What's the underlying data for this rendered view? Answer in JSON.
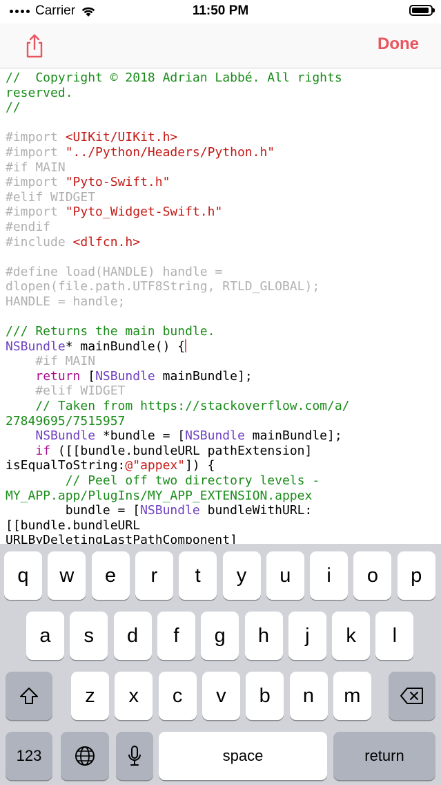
{
  "status_bar": {
    "carrier": "Carrier",
    "time": "11:50 PM",
    "wifi_icon": "wifi-icon",
    "battery_icon": "battery-icon"
  },
  "nav_bar": {
    "share_icon": "share-icon",
    "done_label": "Done",
    "accent_color": "#e8555e"
  },
  "editor": {
    "colors": {
      "comment": "#1a8c1a",
      "preprocessor": "#b0b0b0",
      "string": "#c41a16",
      "keyword": "#aa0d91",
      "type": "#6f41c1",
      "cursor": "#e8555e"
    },
    "lines": [
      [
        {
          "t": "//  Copyright © 2018 Adrian Labbé. All rights",
          "c": "c"
        }
      ],
      [
        {
          "t": "reserved.",
          "c": "c"
        }
      ],
      [
        {
          "t": "//",
          "c": "c"
        }
      ],
      [],
      [
        {
          "t": "#import ",
          "c": "p"
        },
        {
          "t": "<UIKit/UIKit.h>",
          "c": "s"
        }
      ],
      [
        {
          "t": "#import ",
          "c": "p"
        },
        {
          "t": "\"../Python/Headers/Python.h\"",
          "c": "s"
        }
      ],
      [
        {
          "t": "#if MAIN",
          "c": "p"
        }
      ],
      [
        {
          "t": "#import ",
          "c": "p"
        },
        {
          "t": "\"Pyto-Swift.h\"",
          "c": "s"
        }
      ],
      [
        {
          "t": "#elif WIDGET",
          "c": "p"
        }
      ],
      [
        {
          "t": "#import ",
          "c": "p"
        },
        {
          "t": "\"Pyto_Widget-Swift.h\"",
          "c": "s"
        }
      ],
      [
        {
          "t": "#endif",
          "c": "p"
        }
      ],
      [
        {
          "t": "#include ",
          "c": "p"
        },
        {
          "t": "<dlfcn.h>",
          "c": "s"
        }
      ],
      [],
      [
        {
          "t": "#define load(HANDLE) handle =",
          "c": "p"
        }
      ],
      [
        {
          "t": "dlopen(file.path.UTF8String, RTLD_GLOBAL);",
          "c": "p"
        }
      ],
      [
        {
          "t": "HANDLE = handle;",
          "c": "p"
        }
      ],
      [],
      [
        {
          "t": "/// Returns the main bundle.",
          "c": "c"
        }
      ],
      [
        {
          "t": "NSBundle",
          "c": "t"
        },
        {
          "t": "* mainBundle() {",
          "c": "n"
        },
        {
          "cursor": true
        }
      ],
      [
        {
          "t": "    #if MAIN",
          "c": "p"
        }
      ],
      [
        {
          "t": "    ",
          "c": "n"
        },
        {
          "t": "return",
          "c": "k"
        },
        {
          "t": " [",
          "c": "n"
        },
        {
          "t": "NSBundle",
          "c": "t"
        },
        {
          "t": " mainBundle];",
          "c": "n"
        }
      ],
      [
        {
          "t": "    #elif WIDGET",
          "c": "p"
        }
      ],
      [
        {
          "t": "    // Taken from https://stackoverflow.com/a/",
          "c": "c"
        }
      ],
      [
        {
          "t": "27849695/7515957",
          "c": "c"
        }
      ],
      [
        {
          "t": "    ",
          "c": "n"
        },
        {
          "t": "NSBundle",
          "c": "t"
        },
        {
          "t": " *bundle = [",
          "c": "n"
        },
        {
          "t": "NSBundle",
          "c": "t"
        },
        {
          "t": " mainBundle];",
          "c": "n"
        }
      ],
      [
        {
          "t": "    ",
          "c": "n"
        },
        {
          "t": "if",
          "c": "k"
        },
        {
          "t": " ([[bundle.bundleURL pathExtension]",
          "c": "n"
        }
      ],
      [
        {
          "t": "isEqualToString:",
          "c": "n"
        },
        {
          "t": "@\"appex\"",
          "c": "s"
        },
        {
          "t": "]) {",
          "c": "n"
        }
      ],
      [
        {
          "t": "        // Peel off two directory levels -",
          "c": "c"
        }
      ],
      [
        {
          "t": "MY_APP.app/PlugIns/MY_APP_EXTENSION.appex",
          "c": "c"
        }
      ],
      [
        {
          "t": "        bundle = [",
          "c": "n"
        },
        {
          "t": "NSBundle",
          "c": "t"
        },
        {
          "t": " bundleWithURL:",
          "c": "n"
        }
      ],
      [
        {
          "t": "[[bundle.bundleURL",
          "c": "n"
        }
      ],
      [
        {
          "t": "URLByDeletingLastPathComponent]",
          "c": "n"
        }
      ]
    ]
  },
  "keyboard": {
    "row1": [
      "q",
      "w",
      "e",
      "r",
      "t",
      "y",
      "u",
      "i",
      "o",
      "p"
    ],
    "row2": [
      "a",
      "s",
      "d",
      "f",
      "g",
      "h",
      "j",
      "k",
      "l"
    ],
    "row3": [
      "z",
      "x",
      "c",
      "v",
      "b",
      "n",
      "m"
    ],
    "shift_icon": "shift-icon",
    "delete_icon": "delete-icon",
    "globe_icon": "globe-icon",
    "mic_icon": "microphone-icon",
    "numbers_label": "123",
    "space_label": "space",
    "return_label": "return"
  }
}
